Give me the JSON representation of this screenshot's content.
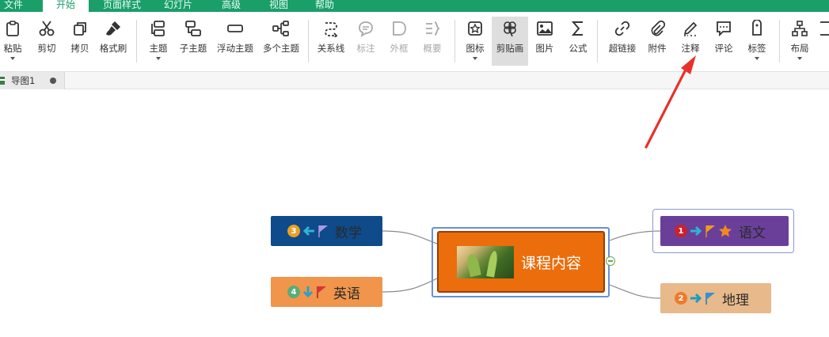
{
  "menu": {
    "items": [
      {
        "label": "文件",
        "active": false
      },
      {
        "label": "开始",
        "active": true
      },
      {
        "label": "页面样式",
        "active": false
      },
      {
        "label": "幻灯片",
        "active": false
      },
      {
        "label": "高级",
        "active": false
      },
      {
        "label": "视图",
        "active": false
      },
      {
        "label": "帮助",
        "active": false
      }
    ]
  },
  "toolbar": {
    "paste": "粘贴",
    "cut": "剪切",
    "copy": "拷贝",
    "format_painter": "格式刷",
    "topic": "主题",
    "subtopic": "子主题",
    "floating_topic": "浮动主题",
    "multiple_topics": "多个主题",
    "relationship": "关系线",
    "callout": "标注",
    "boundary": "外框",
    "summary": "概要",
    "icon": "图标",
    "clipart": "剪贴画",
    "image": "图片",
    "formula": "公式",
    "hyperlink": "超链接",
    "attachment": "附件",
    "note": "注释",
    "comment": "评论",
    "tag": "标签",
    "layout": "布局"
  },
  "doc_tab": {
    "label": "导图1"
  },
  "mindmap": {
    "central": {
      "label": "课程内容",
      "color": "#eb6d0c"
    },
    "nodes": [
      {
        "id": "math",
        "label": "数学",
        "priority": "3",
        "bg": "#0f4a8a",
        "text": "#2a2a2a",
        "side": "left"
      },
      {
        "id": "english",
        "label": "英语",
        "priority": "4",
        "bg": "#f0954b",
        "text": "#2a2a2a",
        "side": "left"
      },
      {
        "id": "chinese",
        "label": "语文",
        "priority": "1",
        "bg": "#6a3f9a",
        "text": "#2a2a2a",
        "side": "right"
      },
      {
        "id": "geography",
        "label": "地理",
        "priority": "2",
        "bg": "#e8b98a",
        "text": "#2a2a2a",
        "side": "right"
      }
    ]
  },
  "colors": {
    "brand": "#1a9e6a",
    "annotation_arrow": "#e8312a"
  }
}
